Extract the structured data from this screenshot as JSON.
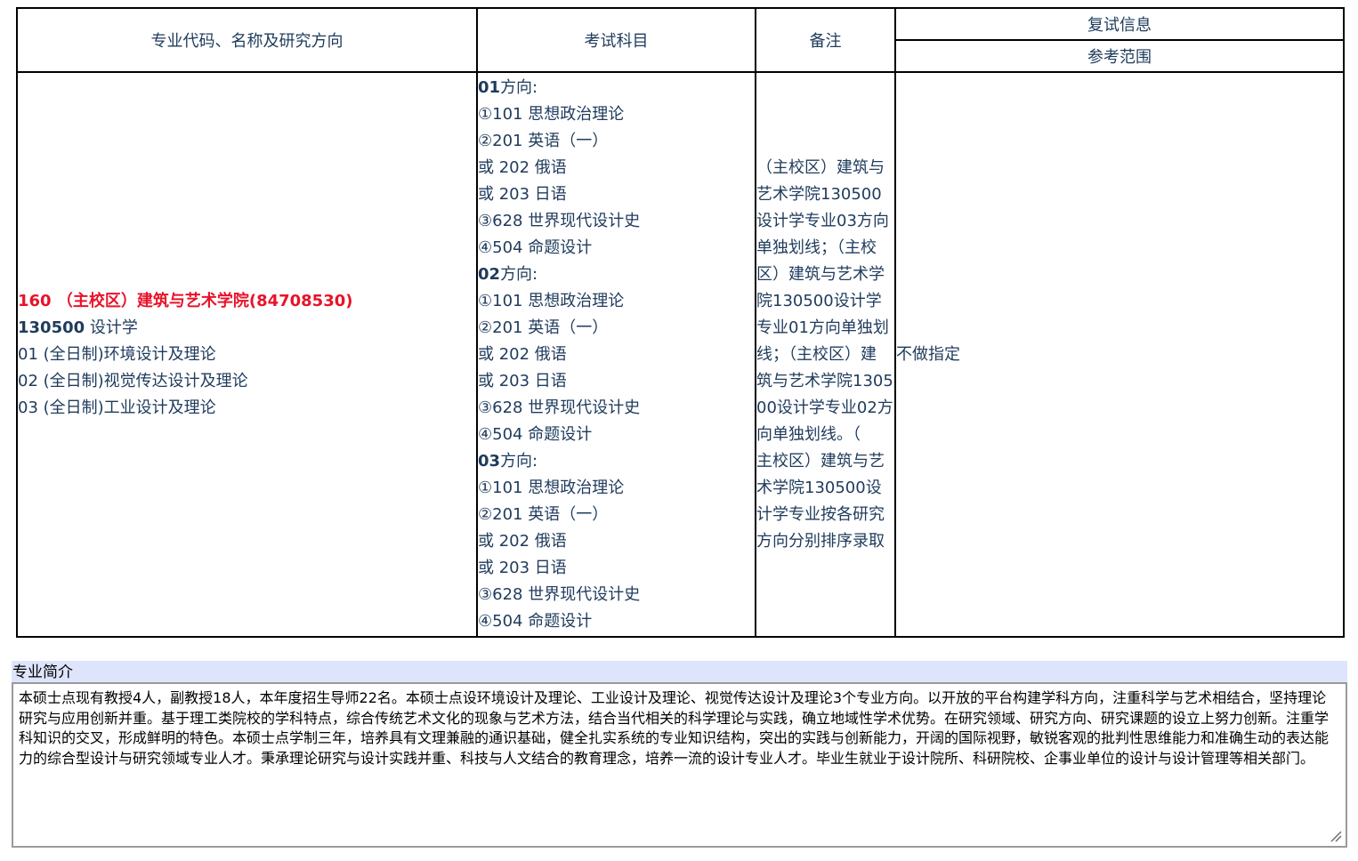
{
  "table": {
    "headers": {
      "major": "专业代码、名称及研究方向",
      "subjects": "考试科目",
      "remarks": "备注",
      "retest": "复试信息",
      "retest_scope": "参考范围"
    },
    "major": {
      "college": "160 （主校区）建筑与艺术学院(84708530)",
      "code": "130500",
      "name": " 设计学",
      "directions": [
        "01 (全日制)环境设计及理论",
        "02 (全日制)视觉传达设计及理论",
        "03 (全日制)工业设计及理论"
      ]
    },
    "subjects": [
      {
        "code": "01",
        "suffix": "方向:",
        "items": [
          "①101 思想政治理论",
          "②201 英语（一）",
          "或 202 俄语",
          "或 203 日语",
          "③628 世界现代设计史",
          "④504 命题设计"
        ]
      },
      {
        "code": "02",
        "suffix": "方向:",
        "items": [
          "①101 思想政治理论",
          "②201 英语（一）",
          "或 202 俄语",
          "或 203 日语",
          "③628 世界现代设计史",
          "④504 命题设计"
        ]
      },
      {
        "code": "03",
        "suffix": "方向:",
        "items": [
          "①101 思想政治理论",
          "②201 英语（一）",
          "或 202 俄语",
          "或 203 日语",
          "③628 世界现代设计史",
          "④504 命题设计"
        ]
      }
    ],
    "remarks_lines": [
      "（主校区）建筑与",
      "艺术学院130500",
      "设计学专业03方向",
      "单独划线；（主校",
      "区）建筑与艺术学",
      "院130500设计学",
      "专业01方向单独划",
      "线；（主校区）建",
      "筑与艺术学院1305",
      "00设计学专业02方",
      "向单独划线。（",
      "主校区）建筑与艺",
      "术学院130500设",
      "计学专业按各研究",
      "方向分别排序录取"
    ],
    "retest_scope": "不做指定"
  },
  "intro": {
    "title": "专业简介",
    "text": "本硕士点现有教授4人，副教授18人，本年度招生导师22名。本硕士点设环境设计及理论、工业设计及理论、视觉传达设计及理论3个专业方向。以开放的平台构建学科方向，注重科学与艺术相结合，坚持理论研究与应用创新并重。基于理工类院校的学科特点，综合传统艺术文化的现象与艺术方法，结合当代相关的科学理论与实践，确立地域性学术优势。在研究领域、研究方向、研究课题的设立上努力创新。注重学科知识的交叉，形成鲜明的特色。本硕士点学制三年，培养具有文理兼融的通识基础，健全扎实系统的专业知识结构，突出的实践与创新能力，开阔的国际视野，敏锐客观的批判性思维能力和准确生动的表达能力的综合型设计与研究领域专业人才。秉承理论研究与设计实践并重、科技与人文结合的教育理念，培养一流的设计专业人才。毕业生就业于设计院所、科研院校、企事业单位的设计与设计管理等相关部门。"
  },
  "colors": {
    "text": "#1f3b5c",
    "college_red": "#e8132a",
    "intro_bar_bg": "#dde4fb"
  }
}
